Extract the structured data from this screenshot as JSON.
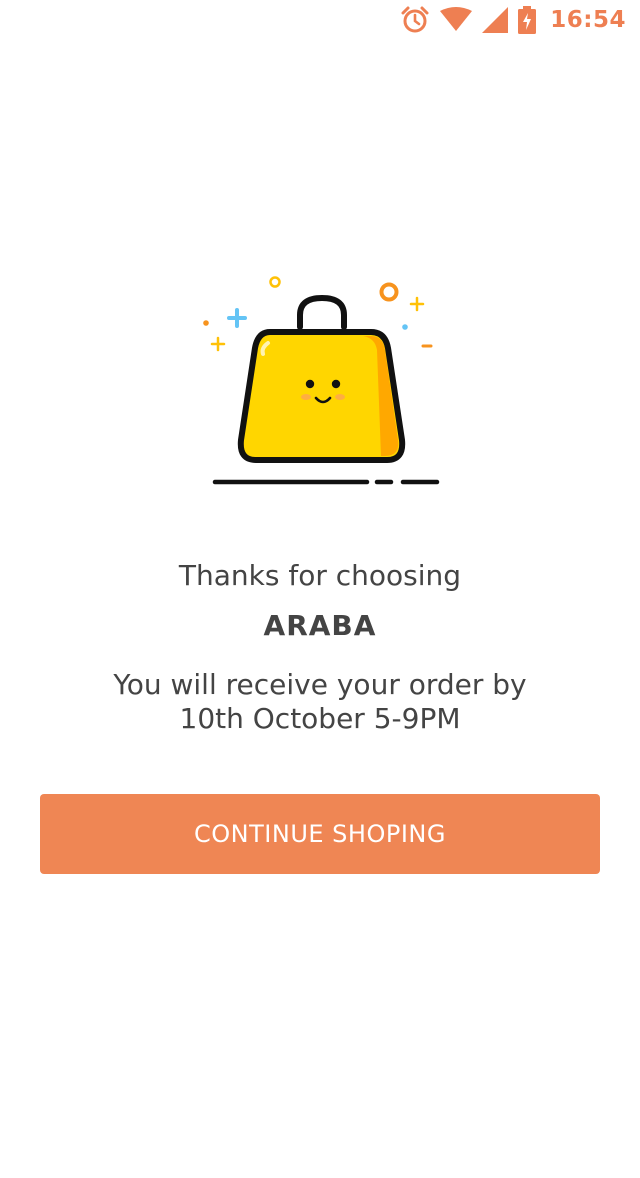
{
  "status_bar": {
    "time": "16:54",
    "icons": [
      "alarm-icon",
      "wifi-icon",
      "signal-icon",
      "battery-charging-icon"
    ],
    "color": "#ee7f52"
  },
  "illustration": {
    "icon": "shopping-bag-icon",
    "colors": {
      "bag_fill": "#ffd600",
      "bag_shade": "#ffa800",
      "outline": "#111111",
      "sparkle_blue": "#64c4f5",
      "sparkle_orange": "#f7931e",
      "sparkle_yellow": "#ffc107"
    }
  },
  "message": {
    "thanks": "Thanks for choosing",
    "brand": "ARABA",
    "delivery_line1": "You will receive your order by",
    "delivery_line2": "10th October 5-9PM"
  },
  "actions": {
    "continue_label": "CONTINUE SHOPING",
    "continue_color": "#ef8654"
  }
}
